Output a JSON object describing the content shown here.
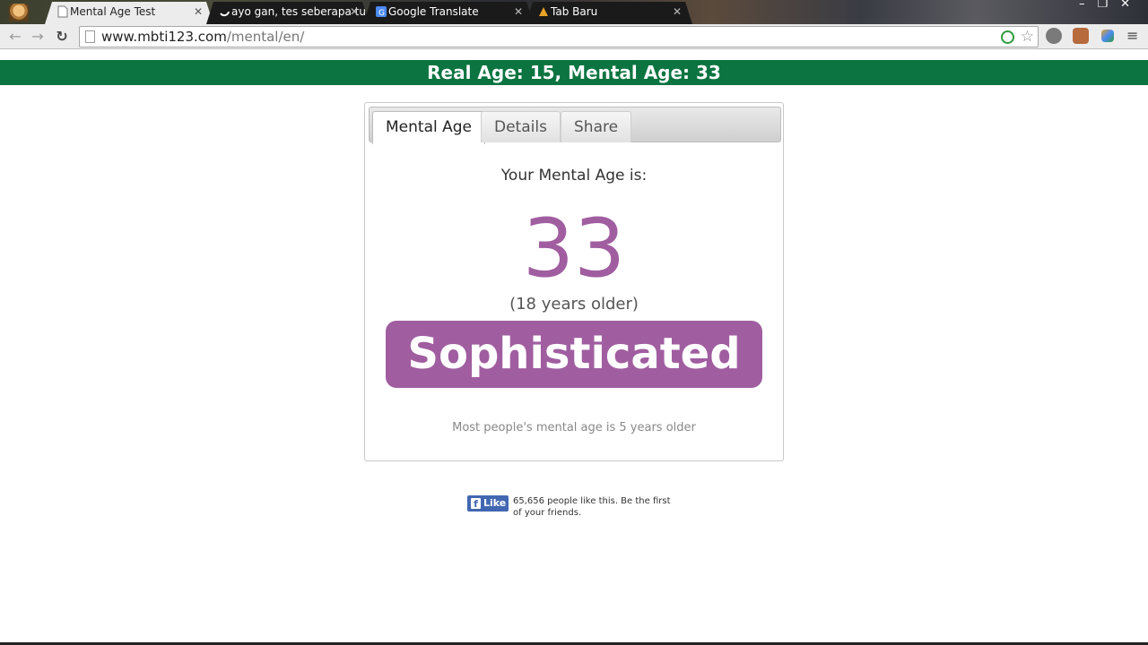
{
  "browser": {
    "tabs": [
      {
        "title": "Mental Age Test",
        "active": true
      },
      {
        "title": "ayo gan, tes seberapa tua",
        "active": false
      },
      {
        "title": "Google Translate",
        "active": false
      },
      {
        "title": "Tab Baru",
        "active": false
      }
    ],
    "url_domain": "www.mbti123.com",
    "url_path": "/mental/en/"
  },
  "banner": {
    "text": "Real Age: 15, Mental Age: 33"
  },
  "card": {
    "tabs": [
      "Mental Age",
      "Details",
      "Share"
    ],
    "result_label": "Your Mental Age is:",
    "age_number": "33",
    "age_diff": "(18 years older)",
    "category": "Sophisticated",
    "footnote": "Most people's mental age is 5 years older"
  },
  "facebook": {
    "button_label": "Like",
    "text": "65,656 people like this. Be the first of your friends."
  },
  "colors": {
    "banner": "#0b7440",
    "accent": "#a05ea0",
    "fb": "#4267b2"
  }
}
